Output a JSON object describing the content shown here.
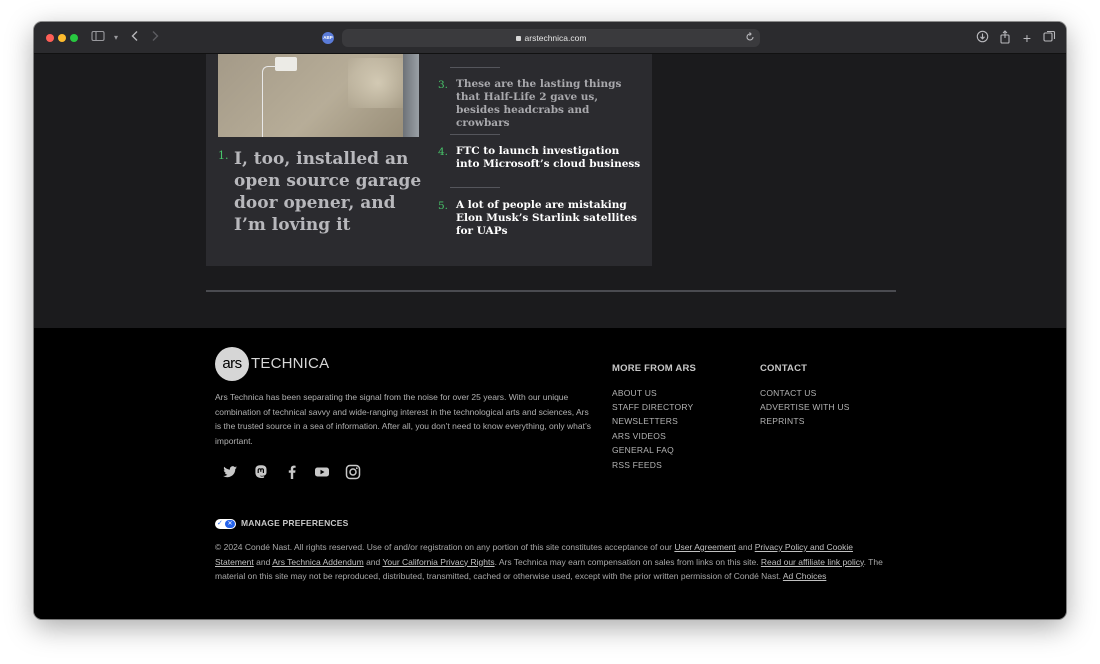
{
  "browser": {
    "url": "arstechnica.com",
    "extension_badge": "ABP"
  },
  "top_stories": {
    "featured": {
      "rank": "1.",
      "title": "I, too, installed an open source garage door opener, and I’m loving it"
    },
    "items": [
      {
        "rank": "3.",
        "title": "These are the lasting things that Half-Life 2 gave us, besides headcrabs and crowbars"
      },
      {
        "rank": "4.",
        "title": "FTC to launch investigation into Microsoft’s cloud business"
      },
      {
        "rank": "5.",
        "title": "A lot of people are mistaking Elon Musk’s Starlink satellites for UAPs"
      }
    ]
  },
  "footer": {
    "logo": {
      "mark": "ars",
      "word": "TECHNICA"
    },
    "about": "Ars Technica has been separating the signal from the noise for over 25 years. With our unique combination of technical savvy and wide-ranging interest in the technological arts and sciences, Ars is the trusted source in a sea of information. After all, you don’t need to know everything, only what’s important.",
    "social_icons": [
      "twitter-icon",
      "mastodon-icon",
      "facebook-icon",
      "youtube-icon",
      "instagram-icon"
    ],
    "more_from_ars": {
      "heading": "MORE FROM ARS",
      "links": [
        "ABOUT US",
        "STAFF DIRECTORY",
        "NEWSLETTERS",
        "ARS VIDEOS",
        "GENERAL FAQ",
        "RSS FEEDS"
      ]
    },
    "contact": {
      "heading": "CONTACT",
      "links": [
        "CONTACT US",
        "ADVERTISE WITH US",
        "REPRINTS"
      ]
    },
    "manage_preferences": "MANAGE PREFERENCES",
    "legal": {
      "t1": "© 2024 Condé Nast. All rights reserved. Use of and/or registration on any portion of this site constitutes acceptance of our ",
      "l1": "User Agreement",
      "t2": " and ",
      "l2": "Privacy Policy and Cookie Statement",
      "t3": " and ",
      "l3": "Ars Technica Addendum",
      "t4": " and ",
      "l4": "Your California Privacy Rights",
      "t5": ". Ars Technica may earn compensation on sales from links on this site. ",
      "l5": "Read our affiliate link policy",
      "t6": ". The material on this site may not be reproduced, distributed, transmitted, cached or otherwise used, except with the prior written permission of Condé Nast. ",
      "l6": "Ad Choices"
    }
  },
  "colors": {
    "accent_green": "#47c46a",
    "page_bg": "#1b1b1d",
    "card_bg": "#2b2b2f",
    "footer_bg": "#000000"
  }
}
